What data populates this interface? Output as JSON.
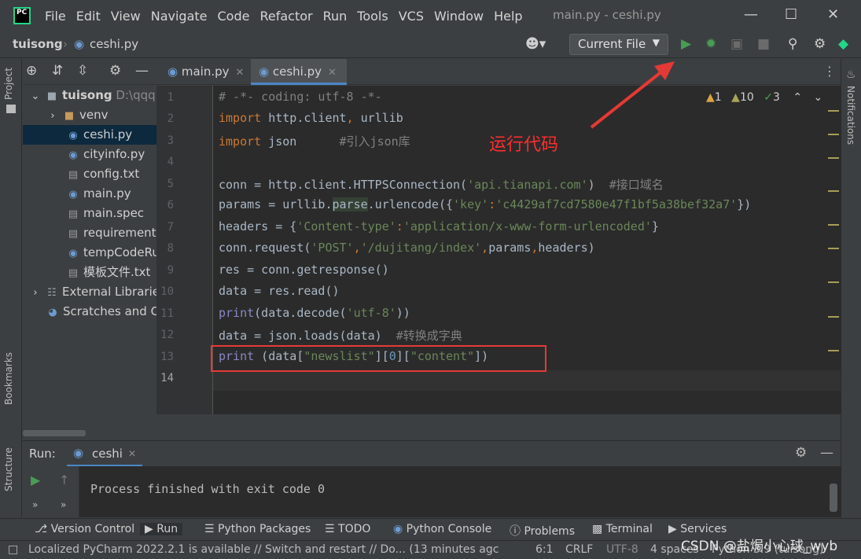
{
  "titlebar": {
    "app_icon": "PC",
    "menu": [
      "File",
      "Edit",
      "View",
      "Navigate",
      "Code",
      "Refactor",
      "Run",
      "Tools",
      "VCS",
      "Window",
      "Help"
    ],
    "title": "main.py - ceshi.py"
  },
  "navbar": {
    "project": "tuisong",
    "file": "ceshi.py",
    "run_config": "Current File"
  },
  "left_strip": {
    "project_label": "Project",
    "bookmarks_label": "Bookmarks",
    "structure_label": "Structure"
  },
  "right_strip": {
    "notifications_label": "Notifications"
  },
  "project_tree": [
    {
      "label": "tuisong",
      "sub": "D:\\qqq",
      "type": "root"
    },
    {
      "label": "venv",
      "type": "folder"
    },
    {
      "label": "ceshi.py",
      "type": "py",
      "selected": true
    },
    {
      "label": "cityinfo.py",
      "type": "py"
    },
    {
      "label": "config.txt",
      "type": "txt"
    },
    {
      "label": "main.py",
      "type": "py"
    },
    {
      "label": "main.spec",
      "type": "txt"
    },
    {
      "label": "requirement",
      "type": "txt"
    },
    {
      "label": "tempCodeRu",
      "type": "py"
    },
    {
      "label": "模板文件.txt",
      "type": "txt"
    },
    {
      "label": "External Librarie",
      "type": "lib"
    },
    {
      "label": "Scratches and C",
      "type": "scratch"
    }
  ],
  "tabs": [
    {
      "label": "main.py",
      "active": false
    },
    {
      "label": "ceshi.py",
      "active": true
    }
  ],
  "inspections": {
    "warnings": "1",
    "weak_warnings": "10",
    "typos": "3"
  },
  "code_lines": [
    "# -*- coding: utf-8 -*-",
    "import http.client, urllib",
    "import json      #引入json库",
    "",
    "conn = http.client.HTTPSConnection('api.tianapi.com')  #接口域名",
    "params = urllib.parse.urlencode({'key':'c4429af7cd7580e47f1bf5a38bef32a7'})",
    "headers = {'Content-type':'application/x-www-form-urlencoded'}",
    "conn.request('POST','/dujitang/index',params,headers)",
    "res = conn.getresponse()",
    "data = res.read()",
    "print(data.decode('utf-8'))",
    "data = json.loads(data)  #转换成字典",
    "print (data[\"newslist\"][0][\"content\"])",
    ""
  ],
  "annotation": {
    "text": "运行代码",
    "color": "#ff2d2d"
  },
  "run_panel": {
    "label": "Run:",
    "config": "ceshi",
    "output": "Process finished with exit code 0"
  },
  "bottom_tools": [
    "Version Control",
    "Run",
    "Python Packages",
    "TODO",
    "Python Console",
    "Problems",
    "Terminal",
    "Services"
  ],
  "status": {
    "message": "Localized PyCharm 2022.2.1 is available // Switch and restart // Do... (13 minutes agc",
    "position": "6:1",
    "line_sep": "CRLF",
    "encoding": "UTF-8",
    "indent": "4 spaces",
    "interpreter": "Python 3.9 (tuisong)",
    "watermark": "CSDN @盐焗小心球_wyb"
  },
  "colors": {
    "accent": "#4a88c7",
    "run_green": "#499c54",
    "annotation_red": "#e53935"
  }
}
